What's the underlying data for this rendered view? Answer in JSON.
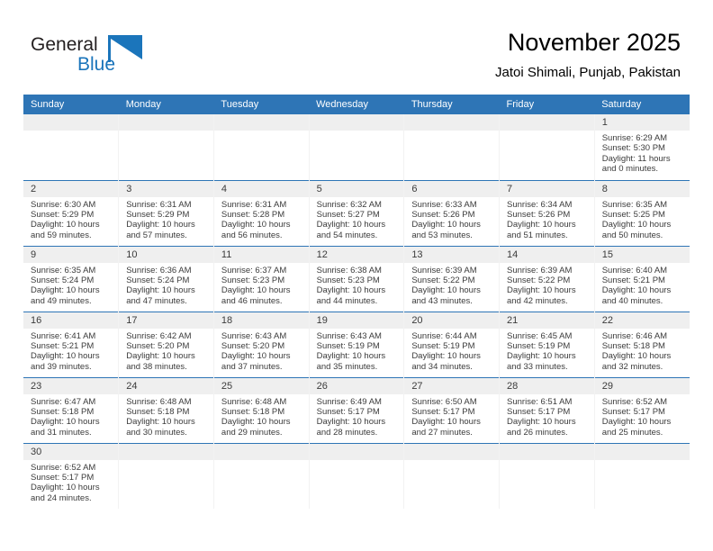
{
  "brand": {
    "name_part1": "General",
    "name_part2": "Blue",
    "flag_icon": "blue-triangle-flag-icon",
    "color_dark": "#231f20",
    "color_blue": "#1b75bb"
  },
  "header": {
    "title": "November 2025",
    "subtitle": "Jatoi Shimali, Punjab, Pakistan"
  },
  "colors": {
    "header_bar": "#2e75b6",
    "daynum_band": "#efefef",
    "text": "#3b3b3b"
  },
  "weekdays": [
    "Sunday",
    "Monday",
    "Tuesday",
    "Wednesday",
    "Thursday",
    "Friday",
    "Saturday"
  ],
  "labels": {
    "sunrise": "Sunrise:",
    "sunset": "Sunset:",
    "daylight": "Daylight:"
  },
  "weeks": [
    [
      {
        "day": "",
        "sunrise": "",
        "sunset": "",
        "daylight": "",
        "empty": true
      },
      {
        "day": "",
        "sunrise": "",
        "sunset": "",
        "daylight": "",
        "empty": true
      },
      {
        "day": "",
        "sunrise": "",
        "sunset": "",
        "daylight": "",
        "empty": true
      },
      {
        "day": "",
        "sunrise": "",
        "sunset": "",
        "daylight": "",
        "empty": true
      },
      {
        "day": "",
        "sunrise": "",
        "sunset": "",
        "daylight": "",
        "empty": true
      },
      {
        "day": "",
        "sunrise": "",
        "sunset": "",
        "daylight": "",
        "empty": true
      },
      {
        "day": "1",
        "sunrise": "Sunrise: 6:29 AM",
        "sunset": "Sunset: 5:30 PM",
        "daylight": "Daylight: 11 hours and 0 minutes.",
        "empty": false
      }
    ],
    [
      {
        "day": "2",
        "sunrise": "Sunrise: 6:30 AM",
        "sunset": "Sunset: 5:29 PM",
        "daylight": "Daylight: 10 hours and 59 minutes.",
        "empty": false
      },
      {
        "day": "3",
        "sunrise": "Sunrise: 6:31 AM",
        "sunset": "Sunset: 5:29 PM",
        "daylight": "Daylight: 10 hours and 57 minutes.",
        "empty": false
      },
      {
        "day": "4",
        "sunrise": "Sunrise: 6:31 AM",
        "sunset": "Sunset: 5:28 PM",
        "daylight": "Daylight: 10 hours and 56 minutes.",
        "empty": false
      },
      {
        "day": "5",
        "sunrise": "Sunrise: 6:32 AM",
        "sunset": "Sunset: 5:27 PM",
        "daylight": "Daylight: 10 hours and 54 minutes.",
        "empty": false
      },
      {
        "day": "6",
        "sunrise": "Sunrise: 6:33 AM",
        "sunset": "Sunset: 5:26 PM",
        "daylight": "Daylight: 10 hours and 53 minutes.",
        "empty": false
      },
      {
        "day": "7",
        "sunrise": "Sunrise: 6:34 AM",
        "sunset": "Sunset: 5:26 PM",
        "daylight": "Daylight: 10 hours and 51 minutes.",
        "empty": false
      },
      {
        "day": "8",
        "sunrise": "Sunrise: 6:35 AM",
        "sunset": "Sunset: 5:25 PM",
        "daylight": "Daylight: 10 hours and 50 minutes.",
        "empty": false
      }
    ],
    [
      {
        "day": "9",
        "sunrise": "Sunrise: 6:35 AM",
        "sunset": "Sunset: 5:24 PM",
        "daylight": "Daylight: 10 hours and 49 minutes.",
        "empty": false
      },
      {
        "day": "10",
        "sunrise": "Sunrise: 6:36 AM",
        "sunset": "Sunset: 5:24 PM",
        "daylight": "Daylight: 10 hours and 47 minutes.",
        "empty": false
      },
      {
        "day": "11",
        "sunrise": "Sunrise: 6:37 AM",
        "sunset": "Sunset: 5:23 PM",
        "daylight": "Daylight: 10 hours and 46 minutes.",
        "empty": false
      },
      {
        "day": "12",
        "sunrise": "Sunrise: 6:38 AM",
        "sunset": "Sunset: 5:23 PM",
        "daylight": "Daylight: 10 hours and 44 minutes.",
        "empty": false
      },
      {
        "day": "13",
        "sunrise": "Sunrise: 6:39 AM",
        "sunset": "Sunset: 5:22 PM",
        "daylight": "Daylight: 10 hours and 43 minutes.",
        "empty": false
      },
      {
        "day": "14",
        "sunrise": "Sunrise: 6:39 AM",
        "sunset": "Sunset: 5:22 PM",
        "daylight": "Daylight: 10 hours and 42 minutes.",
        "empty": false
      },
      {
        "day": "15",
        "sunrise": "Sunrise: 6:40 AM",
        "sunset": "Sunset: 5:21 PM",
        "daylight": "Daylight: 10 hours and 40 minutes.",
        "empty": false
      }
    ],
    [
      {
        "day": "16",
        "sunrise": "Sunrise: 6:41 AM",
        "sunset": "Sunset: 5:21 PM",
        "daylight": "Daylight: 10 hours and 39 minutes.",
        "empty": false
      },
      {
        "day": "17",
        "sunrise": "Sunrise: 6:42 AM",
        "sunset": "Sunset: 5:20 PM",
        "daylight": "Daylight: 10 hours and 38 minutes.",
        "empty": false
      },
      {
        "day": "18",
        "sunrise": "Sunrise: 6:43 AM",
        "sunset": "Sunset: 5:20 PM",
        "daylight": "Daylight: 10 hours and 37 minutes.",
        "empty": false
      },
      {
        "day": "19",
        "sunrise": "Sunrise: 6:43 AM",
        "sunset": "Sunset: 5:19 PM",
        "daylight": "Daylight: 10 hours and 35 minutes.",
        "empty": false
      },
      {
        "day": "20",
        "sunrise": "Sunrise: 6:44 AM",
        "sunset": "Sunset: 5:19 PM",
        "daylight": "Daylight: 10 hours and 34 minutes.",
        "empty": false
      },
      {
        "day": "21",
        "sunrise": "Sunrise: 6:45 AM",
        "sunset": "Sunset: 5:19 PM",
        "daylight": "Daylight: 10 hours and 33 minutes.",
        "empty": false
      },
      {
        "day": "22",
        "sunrise": "Sunrise: 6:46 AM",
        "sunset": "Sunset: 5:18 PM",
        "daylight": "Daylight: 10 hours and 32 minutes.",
        "empty": false
      }
    ],
    [
      {
        "day": "23",
        "sunrise": "Sunrise: 6:47 AM",
        "sunset": "Sunset: 5:18 PM",
        "daylight": "Daylight: 10 hours and 31 minutes.",
        "empty": false
      },
      {
        "day": "24",
        "sunrise": "Sunrise: 6:48 AM",
        "sunset": "Sunset: 5:18 PM",
        "daylight": "Daylight: 10 hours and 30 minutes.",
        "empty": false
      },
      {
        "day": "25",
        "sunrise": "Sunrise: 6:48 AM",
        "sunset": "Sunset: 5:18 PM",
        "daylight": "Daylight: 10 hours and 29 minutes.",
        "empty": false
      },
      {
        "day": "26",
        "sunrise": "Sunrise: 6:49 AM",
        "sunset": "Sunset: 5:17 PM",
        "daylight": "Daylight: 10 hours and 28 minutes.",
        "empty": false
      },
      {
        "day": "27",
        "sunrise": "Sunrise: 6:50 AM",
        "sunset": "Sunset: 5:17 PM",
        "daylight": "Daylight: 10 hours and 27 minutes.",
        "empty": false
      },
      {
        "day": "28",
        "sunrise": "Sunrise: 6:51 AM",
        "sunset": "Sunset: 5:17 PM",
        "daylight": "Daylight: 10 hours and 26 minutes.",
        "empty": false
      },
      {
        "day": "29",
        "sunrise": "Sunrise: 6:52 AM",
        "sunset": "Sunset: 5:17 PM",
        "daylight": "Daylight: 10 hours and 25 minutes.",
        "empty": false
      }
    ],
    [
      {
        "day": "30",
        "sunrise": "Sunrise: 6:52 AM",
        "sunset": "Sunset: 5:17 PM",
        "daylight": "Daylight: 10 hours and 24 minutes.",
        "empty": false
      },
      {
        "day": "",
        "sunrise": "",
        "sunset": "",
        "daylight": "",
        "empty": true
      },
      {
        "day": "",
        "sunrise": "",
        "sunset": "",
        "daylight": "",
        "empty": true
      },
      {
        "day": "",
        "sunrise": "",
        "sunset": "",
        "daylight": "",
        "empty": true
      },
      {
        "day": "",
        "sunrise": "",
        "sunset": "",
        "daylight": "",
        "empty": true
      },
      {
        "day": "",
        "sunrise": "",
        "sunset": "",
        "daylight": "",
        "empty": true
      },
      {
        "day": "",
        "sunrise": "",
        "sunset": "",
        "daylight": "",
        "empty": true
      }
    ]
  ]
}
